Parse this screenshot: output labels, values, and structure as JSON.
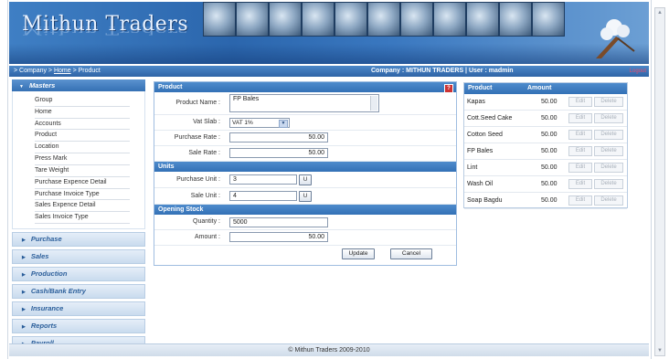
{
  "banner": {
    "logo_text": "Mithun Traders"
  },
  "breadcrumb": {
    "prefix": "> Company > ",
    "home": "Home",
    "suffix": " > Product"
  },
  "topbar": {
    "company_info": "Company : MITHUN TRADERS  |  User : madmin",
    "logout": "Logout"
  },
  "sidebar": {
    "masters_label": "Masters",
    "items": [
      "Group",
      "Home",
      "Accounts",
      "Product",
      "Location",
      "Press Mark",
      "Tare Weight",
      "Purchase Expence Detail",
      "Purchase Invoice Type",
      "Sales Expence Detail",
      "Sales Invoice Type"
    ],
    "sections": [
      "Purchase",
      "Sales",
      "Production",
      "Cash/Bank Entry",
      "Insurance",
      "Reports",
      "Payroll"
    ]
  },
  "form": {
    "product_header": "Product",
    "product_name_label": "Product Name :",
    "product_name_value": "FP Bales",
    "vat_slab_label": "Vat Slab :",
    "vat_slab_value": "VAT 1%",
    "purchase_rate_label": "Purchase Rate :",
    "purchase_rate_value": "50.00",
    "sale_rate_label": "Sale Rate :",
    "sale_rate_value": "50.00",
    "units_header": "Units",
    "purchase_unit_label": "Purchase Unit :",
    "purchase_unit_value": "3",
    "sale_unit_label": "Sale Unit :",
    "sale_unit_value": "4",
    "unit_button": "U",
    "opening_header": "Opening Stock",
    "quantity_label": "Quantity :",
    "quantity_value": "5000",
    "amount_label": "Amount :",
    "amount_value": "50.00",
    "update_button": "Update",
    "cancel_button": "Cancel"
  },
  "product_list": {
    "col_product": "Product",
    "col_amount": "Amount",
    "edit_label": "Edit",
    "delete_label": "Delete",
    "rows": [
      {
        "name": "Kapas",
        "amount": "50.00"
      },
      {
        "name": "Cott.Seed Cake",
        "amount": "50.00"
      },
      {
        "name": "Cotton Seed",
        "amount": "50.00"
      },
      {
        "name": "FP Bales",
        "amount": "50.00"
      },
      {
        "name": "Lint",
        "amount": "50.00"
      },
      {
        "name": "Wash Oil",
        "amount": "50.00"
      },
      {
        "name": "Soap Bagdu",
        "amount": "50.00"
      }
    ]
  },
  "footer": {
    "copyright": "© Mithun Traders 2009-2010"
  },
  "colors": {
    "accent": "#3371b6",
    "header_dark": "#2b66ad",
    "logout": "#e94b6a"
  }
}
